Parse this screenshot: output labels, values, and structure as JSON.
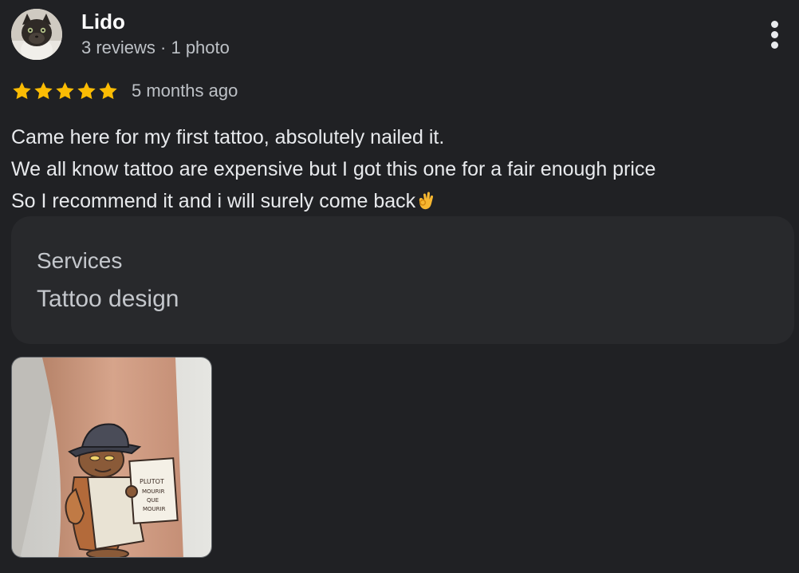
{
  "author": {
    "name": "Lido",
    "meta": "3 reviews · 1 photo"
  },
  "rating": {
    "stars": 5,
    "max_stars": 5,
    "star_color": "#fbbc04",
    "date": "5 months ago"
  },
  "review": {
    "lines": [
      "Came here for my first tattoo, absolutely nailed it.",
      "We all know tattoo are expensive but I got this one for a fair enough price",
      "So I recommend it and i will surely come back"
    ],
    "trailing_emoji": "ok-hand-emoji"
  },
  "services": {
    "title": "Services",
    "value": "Tattoo design"
  },
  "photo": {
    "icon": "tattoo-photo",
    "sign_text": [
      "PLUTOT",
      "MOURIR",
      "QUE",
      "MOURIR"
    ]
  },
  "menu": {
    "icon": "more-vert-icon"
  }
}
